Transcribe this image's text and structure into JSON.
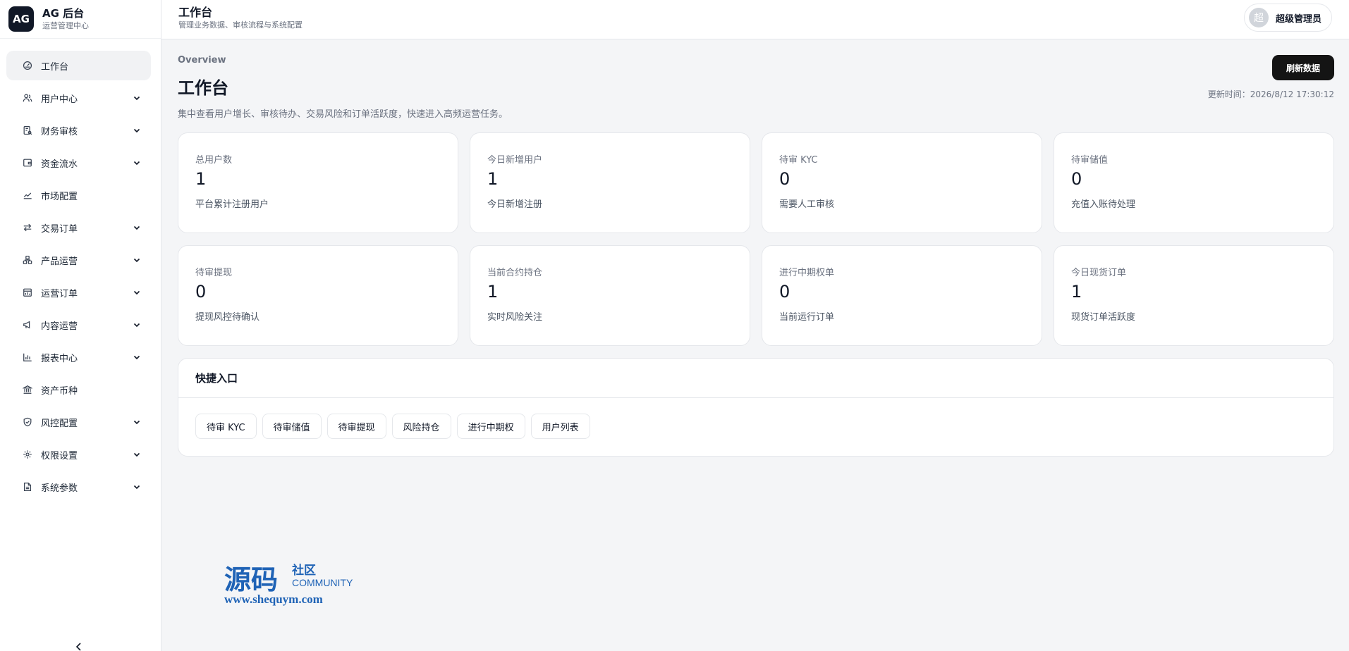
{
  "brand": {
    "logo": "AG",
    "name": "AG 后台",
    "subtitle": "运营管理中心"
  },
  "sidebar": {
    "items": [
      {
        "label": "工作台",
        "icon": "dashboard-icon",
        "expandable": false,
        "active": true
      },
      {
        "label": "用户中心",
        "icon": "users-icon",
        "expandable": true
      },
      {
        "label": "财务审核",
        "icon": "finance-review-icon",
        "expandable": true
      },
      {
        "label": "资金流水",
        "icon": "wallet-icon",
        "expandable": true
      },
      {
        "label": "市场配置",
        "icon": "trend-icon",
        "expandable": false
      },
      {
        "label": "交易订单",
        "icon": "swap-icon",
        "expandable": true
      },
      {
        "label": "产品运营",
        "icon": "product-icon",
        "expandable": true
      },
      {
        "label": "运营订单",
        "icon": "calendar-icon",
        "expandable": true
      },
      {
        "label": "内容运营",
        "icon": "megaphone-icon",
        "expandable": true
      },
      {
        "label": "报表中心",
        "icon": "bar-chart-icon",
        "expandable": true
      },
      {
        "label": "资产币种",
        "icon": "bank-icon",
        "expandable": false
      },
      {
        "label": "风控配置",
        "icon": "shield-icon",
        "expandable": true
      },
      {
        "label": "权限设置",
        "icon": "gear-icon",
        "expandable": true
      },
      {
        "label": "系统参数",
        "icon": "document-icon",
        "expandable": true
      }
    ]
  },
  "topbar": {
    "title": "工作台",
    "subtitle": "管理业务数据、审核流程与系统配置",
    "user_avatar": "超",
    "user_name": "超级管理员"
  },
  "main": {
    "eyebrow": "Overview",
    "title": "工作台",
    "description": "集中查看用户增长、审核待办、交易风险和订单活跃度，快速进入高频运营任务。",
    "refresh_label": "刷新数据",
    "update_time": "更新时间：2026/8/12 17:30:12"
  },
  "stats": [
    {
      "label": "总用户数",
      "value": "1",
      "note": "平台累计注册用户"
    },
    {
      "label": "今日新增用户",
      "value": "1",
      "note": "今日新增注册"
    },
    {
      "label": "待审 KYC",
      "value": "0",
      "note": "需要人工审核"
    },
    {
      "label": "待审储值",
      "value": "0",
      "note": "充值入账待处理"
    },
    {
      "label": "待审提现",
      "value": "0",
      "note": "提现风控待确认"
    },
    {
      "label": "当前合约持仓",
      "value": "1",
      "note": "实时风险关注"
    },
    {
      "label": "进行中期权单",
      "value": "0",
      "note": "当前运行订单"
    },
    {
      "label": "今日现货订单",
      "value": "1",
      "note": "现货订单活跃度"
    }
  ],
  "quick_entry": {
    "title": "快捷入口",
    "buttons": [
      "待审 KYC",
      "待审储值",
      "待审提现",
      "风险持仓",
      "进行中期权",
      "用户列表"
    ]
  },
  "watermark": {
    "text_large": "源码",
    "text_small": "社区",
    "text_english": "COMMUNITY",
    "url": "www.shequym.com"
  },
  "colors": {
    "primary_dark": "#141414",
    "background": "#f4f5f7",
    "card": "#ffffff",
    "muted": "#6b7280",
    "watermark_blue": "#1f63b6",
    "watermark_orange": "#f0a020"
  }
}
